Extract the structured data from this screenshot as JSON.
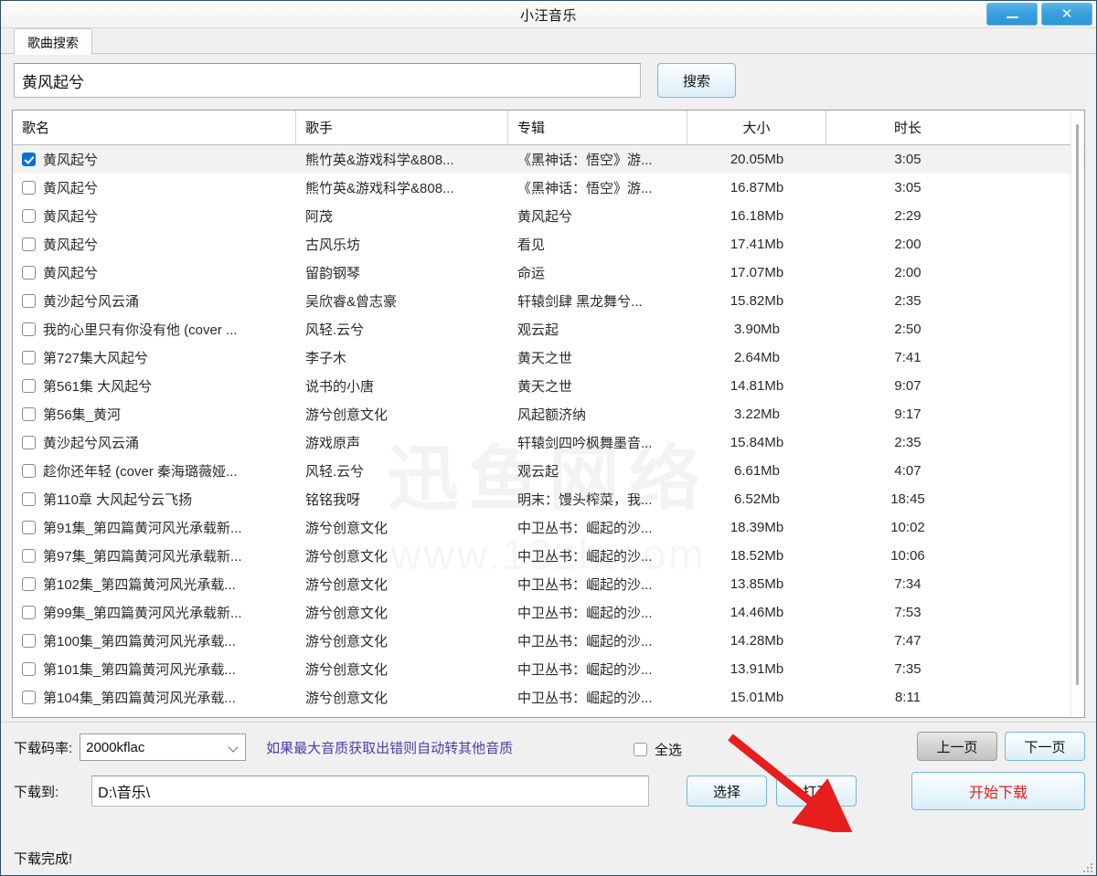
{
  "window": {
    "title": "小汪音乐",
    "minimize_label": "—",
    "close_label": "✕"
  },
  "tabs": [
    {
      "label": "歌曲搜索"
    }
  ],
  "search": {
    "value": "黄风起兮",
    "placeholder": "",
    "button_label": "搜索"
  },
  "table": {
    "columns": [
      "歌名",
      "歌手",
      "专辑",
      "大小",
      "时长"
    ],
    "rows": [
      {
        "checked": true,
        "name": "黄风起兮",
        "artist": "熊竹英&游戏科学&808...",
        "album": "《黑神话：悟空》游...",
        "size": "20.05Mb",
        "duration": "3:05"
      },
      {
        "checked": false,
        "name": "黄风起兮",
        "artist": "熊竹英&游戏科学&808...",
        "album": "《黑神话：悟空》游...",
        "size": "16.87Mb",
        "duration": "3:05"
      },
      {
        "checked": false,
        "name": "黄风起兮",
        "artist": "阿茂",
        "album": "黄风起兮",
        "size": "16.18Mb",
        "duration": "2:29"
      },
      {
        "checked": false,
        "name": "黄风起兮",
        "artist": "古风乐坊",
        "album": "看见",
        "size": "17.41Mb",
        "duration": "2:00"
      },
      {
        "checked": false,
        "name": "黄风起兮",
        "artist": "留韵钢琴",
        "album": "命运",
        "size": "17.07Mb",
        "duration": "2:00"
      },
      {
        "checked": false,
        "name": "黄沙起兮风云涌",
        "artist": "吴欣睿&曾志豪",
        "album": "轩辕剑肆 黑龙舞兮...",
        "size": "15.82Mb",
        "duration": "2:35"
      },
      {
        "checked": false,
        "name": "我的心里只有你没有他 (cover ...",
        "artist": "风轻.云兮",
        "album": "观云起",
        "size": "3.90Mb",
        "duration": "2:50"
      },
      {
        "checked": false,
        "name": "第727集大风起兮",
        "artist": "李子木",
        "album": "黄天之世",
        "size": "2.64Mb",
        "duration": "7:41"
      },
      {
        "checked": false,
        "name": "第561集 大风起兮",
        "artist": "说书的小唐",
        "album": "黄天之世",
        "size": "14.81Mb",
        "duration": "9:07"
      },
      {
        "checked": false,
        "name": "第56集_黄河",
        "artist": "游兮创意文化",
        "album": "风起额济纳",
        "size": "3.22Mb",
        "duration": "9:17"
      },
      {
        "checked": false,
        "name": "黄沙起兮风云涌",
        "artist": "游戏原声",
        "album": "轩辕剑四吟枫舞墨音...",
        "size": "15.84Mb",
        "duration": "2:35"
      },
      {
        "checked": false,
        "name": "趁你还年轻 (cover 秦海璐薇娅...",
        "artist": "风轻.云兮",
        "album": "观云起",
        "size": "6.61Mb",
        "duration": "4:07"
      },
      {
        "checked": false,
        "name": "第110章 大风起兮云飞扬",
        "artist": "铭铭我呀",
        "album": "明末：馒头榨菜，我...",
        "size": "6.52Mb",
        "duration": "18:45"
      },
      {
        "checked": false,
        "name": "第91集_第四篇黄河风光承载新...",
        "artist": "游兮创意文化",
        "album": "中卫丛书：崛起的沙...",
        "size": "18.39Mb",
        "duration": "10:02"
      },
      {
        "checked": false,
        "name": "第97集_第四篇黄河风光承载新...",
        "artist": "游兮创意文化",
        "album": "中卫丛书：崛起的沙...",
        "size": "18.52Mb",
        "duration": "10:06"
      },
      {
        "checked": false,
        "name": "第102集_第四篇黄河风光承载...",
        "artist": "游兮创意文化",
        "album": "中卫丛书：崛起的沙...",
        "size": "13.85Mb",
        "duration": "7:34"
      },
      {
        "checked": false,
        "name": "第99集_第四篇黄河风光承载新...",
        "artist": "游兮创意文化",
        "album": "中卫丛书：崛起的沙...",
        "size": "14.46Mb",
        "duration": "7:53"
      },
      {
        "checked": false,
        "name": "第100集_第四篇黄河风光承载...",
        "artist": "游兮创意文化",
        "album": "中卫丛书：崛起的沙...",
        "size": "14.28Mb",
        "duration": "7:47"
      },
      {
        "checked": false,
        "name": "第101集_第四篇黄河风光承载...",
        "artist": "游兮创意文化",
        "album": "中卫丛书：崛起的沙...",
        "size": "13.91Mb",
        "duration": "7:35"
      },
      {
        "checked": false,
        "name": "第104集_第四篇黄河风光承载...",
        "artist": "游兮创意文化",
        "album": "中卫丛书：崛起的沙...",
        "size": "15.01Mb",
        "duration": "8:11"
      }
    ]
  },
  "watermark": {
    "big": "迅鱼网络",
    "small": "www.13zh.com"
  },
  "bottom": {
    "bitrate_label": "下载码率:",
    "bitrate_value": "2000kflac",
    "bitrate_hint": "如果最大音质获取出错则自动转其他音质",
    "select_all_label": "全选",
    "prev_page_label": "上一页",
    "next_page_label": "下一页",
    "path_label": "下载到:",
    "path_value": "D:\\音乐\\",
    "choose_label": "选择",
    "open_label": "打开",
    "download_label": "开始下载",
    "status": "下载完成!"
  },
  "annotation": {
    "arrow_color": "#e81d1d"
  }
}
